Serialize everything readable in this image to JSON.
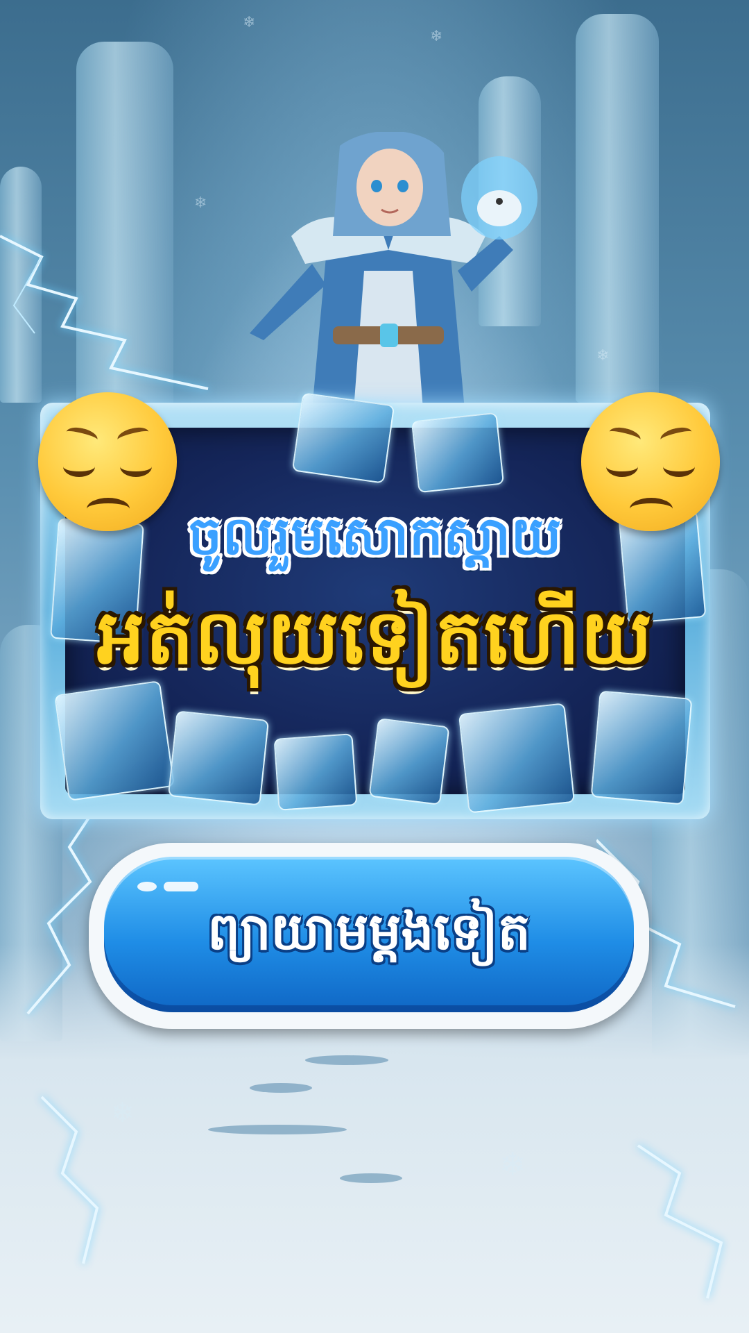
{
  "panel": {
    "title_line1": "ចូលរួមសោកស្តាយ",
    "title_line2": "អត់លុយទៀតហើយ"
  },
  "button": {
    "label": "ព្យាយាមម្តងទៀត"
  },
  "icons": {
    "left_emoji": "pensive-face-icon",
    "right_emoji": "pensive-face-icon"
  },
  "colors": {
    "title_line1": "#3aa0ff",
    "title_line2": "#ffd21f",
    "button": "#1f8de6"
  }
}
